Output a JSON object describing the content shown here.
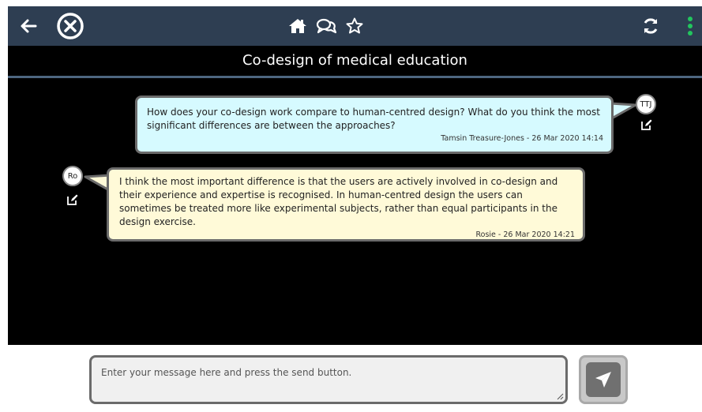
{
  "header": {
    "title": "Co-design of medical education",
    "icons": {
      "back": "back-arrow-icon",
      "close": "close-circle-icon",
      "home": "home-icon",
      "discussion": "discussion-icon",
      "star": "star-icon",
      "refresh": "refresh-icon",
      "more": "more-vertical-icon"
    }
  },
  "messages": [
    {
      "side": "right",
      "avatar": "TTJ",
      "text": "How does your co-design work compare to human-centred design? What do you think the most significant differences are between the approaches?",
      "meta": "Tamsin Treasure-Jones - 26 Mar 2020 14:14",
      "color": "#d6faff"
    },
    {
      "side": "left",
      "avatar": "Ro",
      "text": "I think the most important difference is that the users are actively involved in co-design and their experience and expertise is recognised. In human-centred design the users can sometimes be treated more like experimental subjects, rather than equal participants in the design exercise.",
      "meta": "Rosie - 26 Mar 2020 14:21",
      "color": "#fffad8"
    }
  ],
  "composer": {
    "placeholder": "Enter your message here and press the send button.",
    "value": "",
    "send_icon": "paper-plane-icon"
  },
  "colors": {
    "topbar": "#2e3e52",
    "green_accent": "#22c55e"
  }
}
